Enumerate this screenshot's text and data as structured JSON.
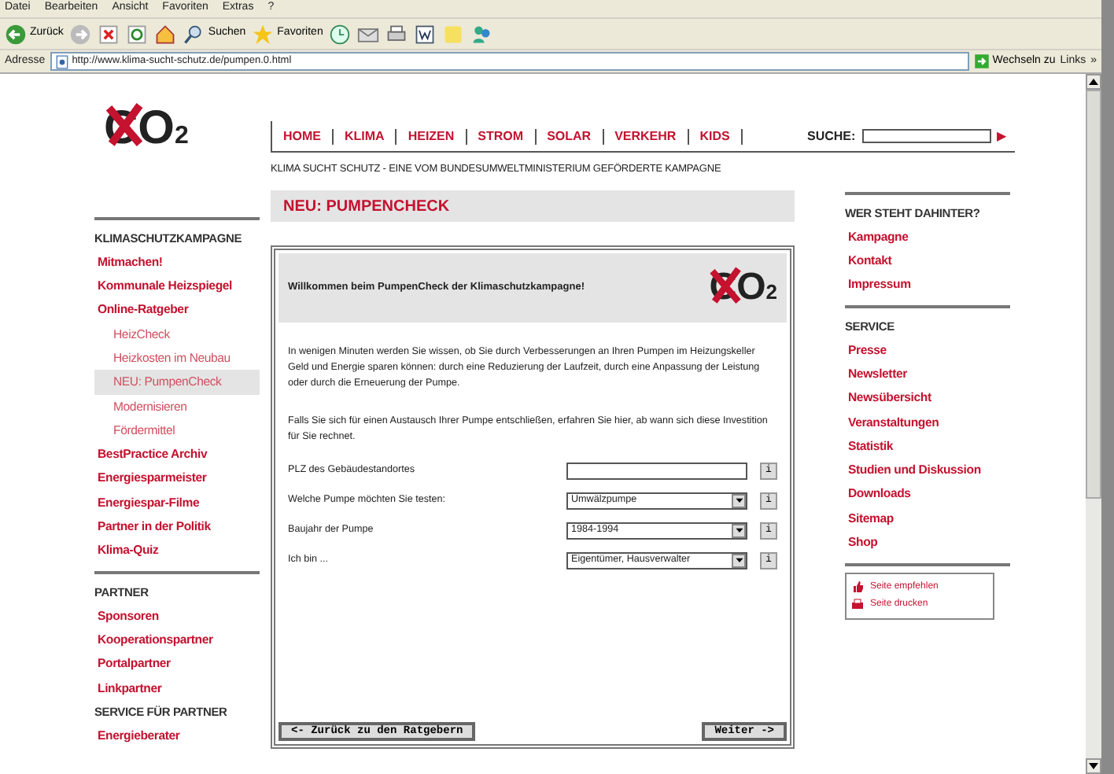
{
  "browser": {
    "menu": [
      "Datei",
      "Bearbeiten",
      "Ansicht",
      "Favoriten",
      "Extras",
      "?"
    ],
    "toolbar": [
      {
        "kind": "back",
        "label": "Zurück"
      },
      {
        "kind": "forward"
      },
      {
        "kind": "stop"
      },
      {
        "kind": "refresh"
      },
      {
        "kind": "home"
      },
      {
        "kind": "search",
        "label": "Suchen"
      },
      {
        "kind": "favorites",
        "label": "Favoriten"
      },
      {
        "kind": "history"
      },
      {
        "kind": "mail"
      },
      {
        "kind": "print"
      },
      {
        "kind": "word"
      },
      {
        "kind": "note"
      },
      {
        "kind": "messenger"
      }
    ],
    "address_label": "Adresse",
    "url": "http://www.klima-sucht-schutz.de/pumpen.0.html",
    "go": "Wechseln zu",
    "links": "Links",
    "more": "»"
  },
  "site": {
    "logo": "CO$_{2}$",
    "nav": [
      "HOME",
      "KLIMA",
      "HEIZEN",
      "STROM",
      "SOLAR",
      "VERKEHR",
      "KIDS"
    ],
    "search_label": "SUCHE:",
    "search_go": "▶",
    "tagline": "KLIMA SUCHT SCHUTZ - EINE VOM BUNDESUMWELTMINISTERIUM GEFÖRDERTE KAMPAGNE",
    "left_nav": [
      {
        "heading": "KLIMASCHUTZKAMPAGNE",
        "divider": true,
        "items": [
          {
            "label": "Mitmachen!",
            "selected": false
          },
          {
            "label": "Kommunale Heizspiegel",
            "selected": false
          },
          {
            "label": "Online-Ratgeber",
            "selected": false,
            "children": [
              {
                "label": "HeizCheck",
                "selected": false
              },
              {
                "label": "Heizkosten im Neubau",
                "selected": false
              },
              {
                "label": "NEU: PumpenCheck",
                "selected": true
              },
              {
                "label": "Modernisieren",
                "selected": false
              },
              {
                "label": "Fördermittel",
                "selected": false
              }
            ]
          },
          {
            "label": "BestPractice Archiv",
            "selected": false
          },
          {
            "label": "Energiesparmeister",
            "selected": false
          },
          {
            "label": "Energiespar-Filme",
            "selected": false
          },
          {
            "label": "Partner in der Politik",
            "selected": false
          },
          {
            "label": "Klima-Quiz",
            "selected": false
          }
        ]
      },
      {
        "heading": "PARTNER",
        "divider": true,
        "items": [
          {
            "label": "Sponsoren",
            "selected": false
          },
          {
            "label": "Kooperationspartner",
            "selected": false
          },
          {
            "label": "Portalpartner",
            "selected": false
          },
          {
            "label": "Linkpartner",
            "selected": false
          }
        ]
      },
      {
        "heading": "SERVICE FÜR PARTNER",
        "divider": false,
        "items": [
          {
            "label": "Energieberater",
            "selected": false
          }
        ]
      }
    ],
    "page_title": "NEU: PUMPENCHECK",
    "form": {
      "title": "Willkommen beim PumpenCheck der Klimaschutzkampagne!",
      "logo": "CO$_{2}$",
      "paragraphs": [
        "In wenigen Minuten werden Sie wissen, ob Sie durch Verbesserungen an Ihren Pumpen im Heizungskeller Geld und Energie sparen können: durch eine Reduzierung der Laufzeit, durch eine Anpassung der Leistung oder durch die Erneuerung der Pumpe.",
        "Falls Sie sich für einen Austausch Ihrer Pumpe entschließen, erfahren Sie hier, ab wann sich diese Investition für Sie rechnet."
      ],
      "fields": [
        {
          "label": "PLZ des Gebäudestandortes",
          "kind": "text",
          "info": "i"
        },
        {
          "label": "Welche Pumpe möchten Sie testen:",
          "kind": "select",
          "value": "Umwälzpumpe",
          "info": "i"
        },
        {
          "label": "Baujahr der Pumpe",
          "kind": "select",
          "value": "1984-1994",
          "info": "i"
        },
        {
          "label": "Ich bin ...",
          "kind": "select",
          "value": "Eigentümer, Hausverwalter",
          "info": "i"
        }
      ],
      "back": "<- Zurück zu den Ratgebern",
      "next": "Weiter ->"
    },
    "right_nav": [
      {
        "heading": "WER STEHT DAHINTER?",
        "items": [
          "Kampagne",
          "Kontakt",
          "Impressum"
        ]
      },
      {
        "heading": "SERVICE",
        "items": [
          "Presse",
          "Newsletter",
          "Newsübersicht",
          "Veranstaltungen",
          "Statistik",
          "Studien und Diskussion",
          "Downloads",
          "Sitemap",
          "Shop"
        ]
      }
    ],
    "actions": [
      {
        "kind": "recommend",
        "label": "Seite empfehlen"
      },
      {
        "kind": "print",
        "label": "Seite drucken"
      }
    ]
  }
}
